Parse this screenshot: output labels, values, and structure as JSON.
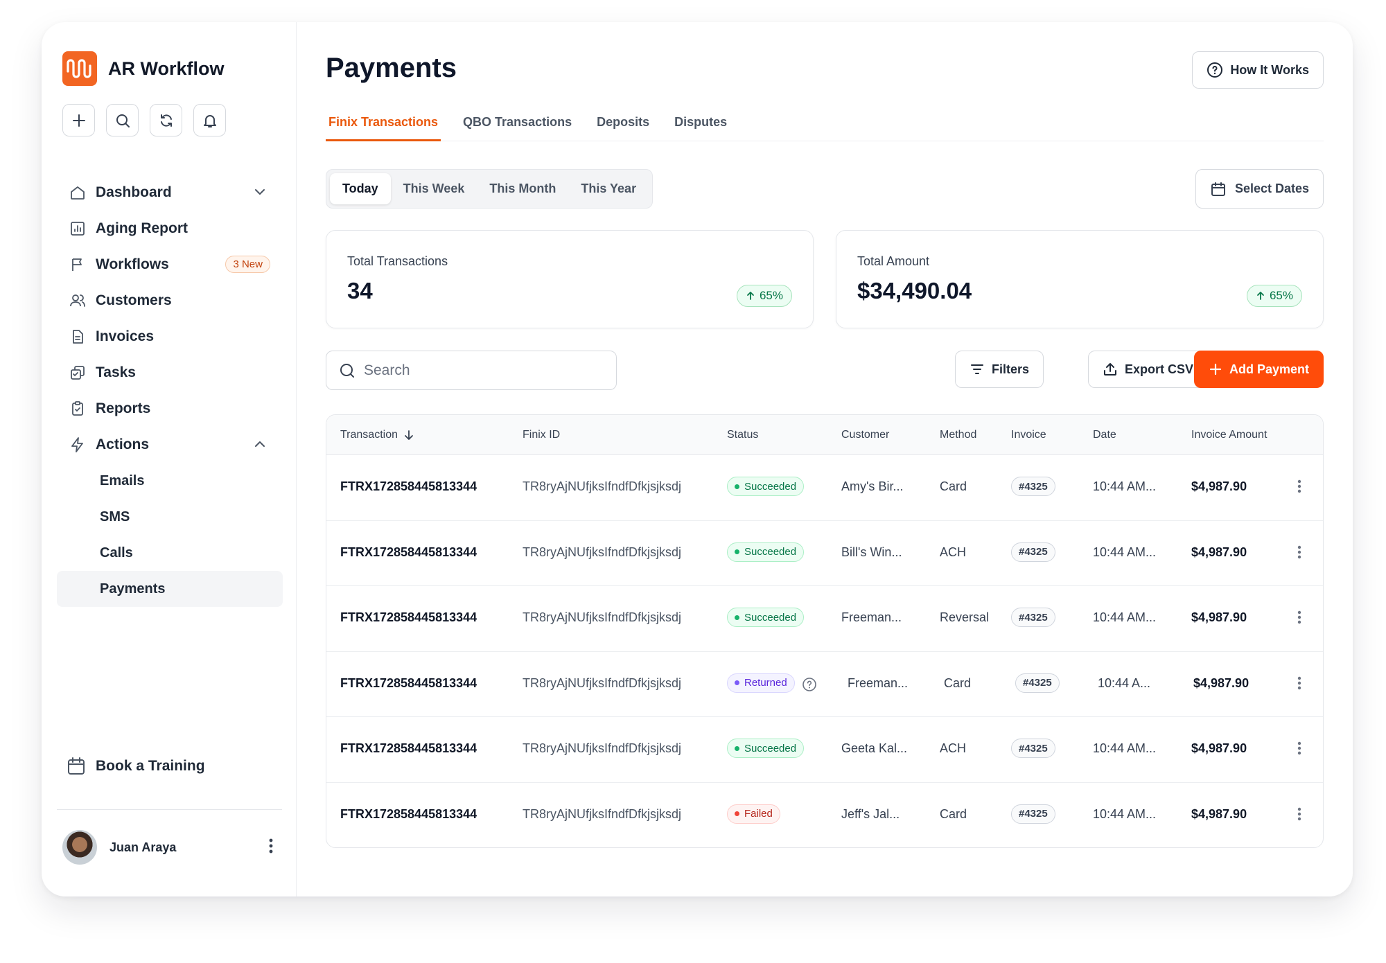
{
  "brand": {
    "name": "AR Workflow",
    "accent": "#f26522"
  },
  "quick_actions": [
    {
      "icon": "plus-icon"
    },
    {
      "icon": "search-icon"
    },
    {
      "icon": "refresh-icon"
    },
    {
      "icon": "bell-icon"
    }
  ],
  "sidebar": {
    "items": [
      {
        "label": "Dashboard",
        "icon": "home-icon",
        "chevron": "down"
      },
      {
        "label": "Aging Report",
        "icon": "bar-chart-icon"
      },
      {
        "label": "Workflows",
        "icon": "flag-icon",
        "badge": "3 New"
      },
      {
        "label": "Customers",
        "icon": "users-icon"
      },
      {
        "label": "Invoices",
        "icon": "document-icon"
      },
      {
        "label": "Tasks",
        "icon": "tasks-icon"
      },
      {
        "label": "Reports",
        "icon": "clipboard-icon"
      },
      {
        "label": "Actions",
        "icon": "lightning-icon",
        "chevron": "up"
      }
    ],
    "sub_items": [
      "Emails",
      "SMS",
      "Calls",
      "Payments"
    ],
    "active_sub": "Payments",
    "book_training": "Book a Training",
    "user": {
      "name": "Juan Araya"
    }
  },
  "header": {
    "title": "Payments",
    "how_it_works": "How It Works"
  },
  "tabs": [
    "Finix Transactions",
    "QBO Transactions",
    "Deposits",
    "Disputes"
  ],
  "active_tab": "Finix Transactions",
  "ranges": [
    "Today",
    "This Week",
    "This Month",
    "This Year"
  ],
  "active_range": "Today",
  "select_dates": "Select Dates",
  "stats": [
    {
      "label": "Total Transactions",
      "value": "34",
      "delta": "65%"
    },
    {
      "label": "Total Amount",
      "value": "$34,490.04",
      "delta": "65%"
    }
  ],
  "search": {
    "placeholder": "Search"
  },
  "toolbar": {
    "filters": "Filters",
    "export": "Export CSV",
    "add": "Add Payment"
  },
  "table": {
    "columns": [
      "Transaction",
      "Finix ID",
      "Status",
      "Customer",
      "Method",
      "Invoice",
      "Date",
      "Invoice Amount"
    ],
    "rows": [
      {
        "transaction": "FTRX172858445813344",
        "finix_id": "TR8ryAjNUfjksIfndfDfkjsjksdj",
        "status": "Succeeded",
        "status_type": "succeeded",
        "customer": "Amy's Bir...",
        "method": "Card",
        "invoice": "#4325",
        "date": "10:44 AM...",
        "amount": "$4,987.90"
      },
      {
        "transaction": "FTRX172858445813344",
        "finix_id": "TR8ryAjNUfjksIfndfDfkjsjksdj",
        "status": "Succeeded",
        "status_type": "succeeded",
        "customer": "Bill's Win...",
        "method": "ACH",
        "invoice": "#4325",
        "date": "10:44 AM...",
        "amount": "$4,987.90"
      },
      {
        "transaction": "FTRX172858445813344",
        "finix_id": "TR8ryAjNUfjksIfndfDfkjsjksdj",
        "status": "Succeeded",
        "status_type": "succeeded",
        "customer": "Freeman...",
        "method": "Reversal",
        "invoice": "#4325",
        "date": "10:44 AM...",
        "amount": "$4,987.90"
      },
      {
        "transaction": "FTRX172858445813344",
        "finix_id": "TR8ryAjNUfjksIfndfDfkjsjksdj",
        "status": "Returned",
        "status_type": "returned",
        "customer": "Freeman...",
        "method": "Card",
        "invoice": "#4325",
        "date": "10:44 A...",
        "amount": "$4,987.90"
      },
      {
        "transaction": "FTRX172858445813344",
        "finix_id": "TR8ryAjNUfjksIfndfDfkjsjksdj",
        "status": "Succeeded",
        "status_type": "succeeded",
        "customer": "Geeta Kal...",
        "method": "ACH",
        "invoice": "#4325",
        "date": "10:44 AM...",
        "amount": "$4,987.90"
      },
      {
        "transaction": "FTRX172858445813344",
        "finix_id": "TR8ryAjNUfjksIfndfDfkjsjksdj",
        "status": "Failed",
        "status_type": "failed",
        "customer": "Jeff's Jal...",
        "method": "Card",
        "invoice": "#4325",
        "date": "10:44 AM...",
        "amount": "$4,987.90"
      }
    ]
  }
}
